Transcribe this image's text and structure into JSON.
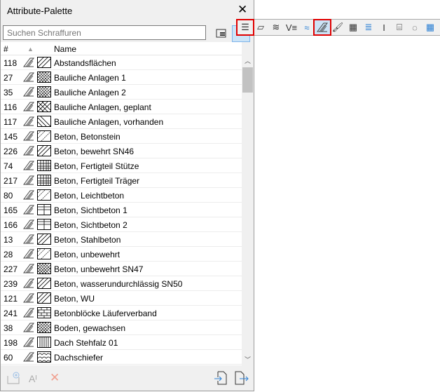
{
  "title": "Attribute-Palette",
  "search": {
    "placeholder": "Suchen Schraffuren"
  },
  "header": {
    "num": "#",
    "name": "Name"
  },
  "rows": [
    {
      "num": "118",
      "name": "Abstandsflächen",
      "pattern": "diag"
    },
    {
      "num": "27",
      "name": "Bauliche Anlagen 1",
      "pattern": "cross"
    },
    {
      "num": "35",
      "name": "Bauliche Anlagen 2",
      "pattern": "cross"
    },
    {
      "num": "116",
      "name": "Bauliche Anlagen, geplant",
      "pattern": "bigcross"
    },
    {
      "num": "117",
      "name": "Bauliche Anlagen, vorhanden",
      "pattern": "backdiag"
    },
    {
      "num": "145",
      "name": "Beton, Betonstein",
      "pattern": "dots"
    },
    {
      "num": "226",
      "name": "Beton, bewehrt SN46",
      "pattern": "diag"
    },
    {
      "num": "74",
      "name": "Beton, Fertigteil Stütze",
      "pattern": "grid"
    },
    {
      "num": "217",
      "name": "Beton, Fertigteil Träger",
      "pattern": "grid"
    },
    {
      "num": "80",
      "name": "Beton, Leichtbeton",
      "pattern": "dots"
    },
    {
      "num": "165",
      "name": "Beton, Sichtbeton 1",
      "pattern": "biggrid"
    },
    {
      "num": "166",
      "name": "Beton, Sichtbeton 2",
      "pattern": "biggrid"
    },
    {
      "num": "13",
      "name": "Beton, Stahlbeton",
      "pattern": "diag"
    },
    {
      "num": "28",
      "name": "Beton, unbewehrt",
      "pattern": "dots"
    },
    {
      "num": "227",
      "name": "Beton, unbewehrt SN47",
      "pattern": "cross"
    },
    {
      "num": "239",
      "name": "Beton, wasserundurchlässig SN50",
      "pattern": "diag"
    },
    {
      "num": "121",
      "name": "Beton, WU",
      "pattern": "diag"
    },
    {
      "num": "241",
      "name": "Betonblöcke Läuferverband",
      "pattern": "brick"
    },
    {
      "num": "38",
      "name": "Boden, gewachsen",
      "pattern": "cross"
    },
    {
      "num": "198",
      "name": "Dach Stehfalz 01",
      "pattern": "vert"
    },
    {
      "num": "60",
      "name": "Dachschiefer",
      "pattern": "scale"
    }
  ],
  "toolbar": {
    "items": [
      "list",
      "slab",
      "stair",
      "line",
      "fill",
      "hatch",
      "paint",
      "brick",
      "layers",
      "profile",
      "zone",
      "mep",
      "table"
    ],
    "active": "hatch"
  },
  "colors": {
    "highlight": "#e00000",
    "accent": "#2a7fd4"
  }
}
